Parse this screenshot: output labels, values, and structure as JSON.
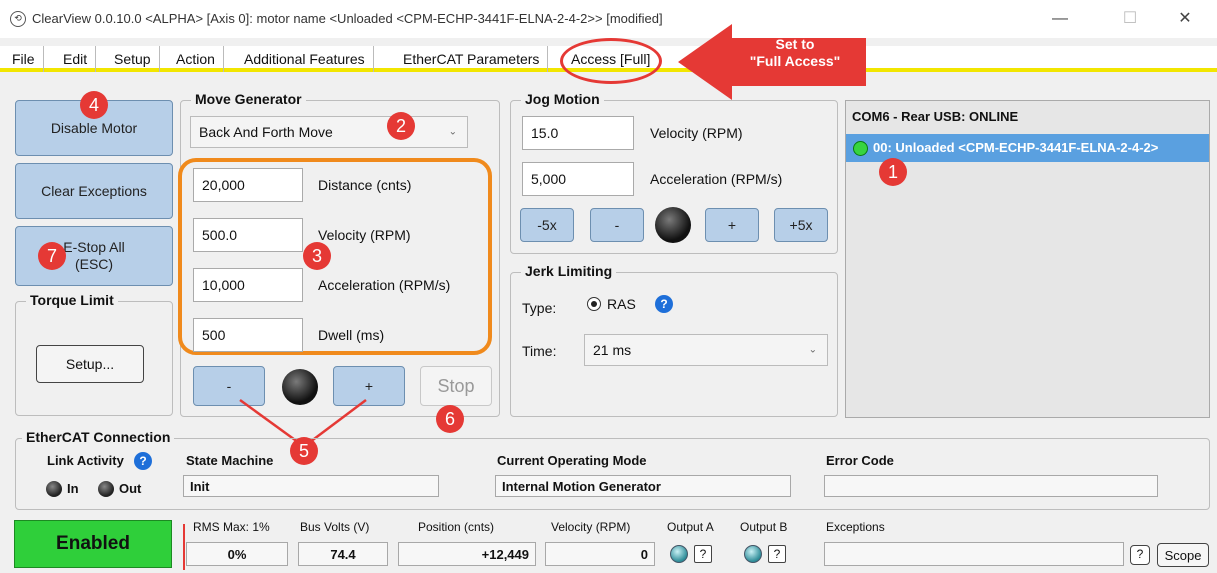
{
  "window": {
    "title": "ClearView 0.0.10.0 <ALPHA> [Axis 0]: motor name <Unloaded <CPM-ECHP-3441F-ELNA-2-4-2>> [modified]",
    "minimize": "—",
    "maximize": "☐",
    "close": "✕"
  },
  "menu": [
    "File",
    "Edit",
    "Setup",
    "Action",
    "Additional Features",
    "EtherCAT Parameters",
    "Access [Full]"
  ],
  "callout": {
    "line1": "Set to",
    "line2": "\"Full Access\""
  },
  "left": {
    "disable_motor": "Disable Motor",
    "clear_exceptions": "Clear Exceptions",
    "estop_line1": "E-Stop All",
    "estop_line2": "(ESC)",
    "torque_title": "Torque Limit",
    "setup": "Setup..."
  },
  "move_generator": {
    "title": "Move Generator",
    "mode": "Back And Forth Move",
    "fields": [
      {
        "value": "20,000",
        "label": "Distance (cnts)"
      },
      {
        "value": "500.0",
        "label": "Velocity (RPM)"
      },
      {
        "value": "10,000",
        "label": "Acceleration (RPM/s)"
      },
      {
        "value": "500",
        "label": "Dwell (ms)"
      }
    ],
    "minus": "-",
    "plus": "+",
    "stop": "Stop"
  },
  "jog": {
    "title": "Jog Motion",
    "velocity_value": "15.0",
    "velocity_label": "Velocity (RPM)",
    "accel_value": "5,000",
    "accel_label": "Acceleration (RPM/s)",
    "buttons": [
      "-5x",
      "-",
      "+",
      "+5x"
    ]
  },
  "jerk": {
    "title": "Jerk Limiting",
    "type_label": "Type:",
    "type_value": "RAS",
    "help": "?",
    "time_label": "Time:",
    "time_value": "21 ms"
  },
  "com": {
    "header": "COM6 - Rear USB: ONLINE",
    "node": "00: Unloaded <CPM-ECHP-3441F-ELNA-2-4-2>"
  },
  "ethercat": {
    "title": "EtherCAT Connection",
    "link_activity": "Link Activity",
    "help": "?",
    "in": "In",
    "out": "Out",
    "state_machine_label": "State Machine",
    "state_machine_value": "Init",
    "op_mode_label": "Current Operating Mode",
    "op_mode_value": "Internal Motion Generator",
    "error_code_label": "Error Code",
    "error_code_value": ""
  },
  "status": {
    "enabled": "Enabled",
    "rms_label": "RMS Max: 1%",
    "rms_value": "0%",
    "bus_label": "Bus Volts (V)",
    "bus_value": "74.4",
    "pos_label": "Position (cnts)",
    "pos_value": "+12,449",
    "vel_label": "Velocity (RPM)",
    "vel_value": "0",
    "outa_label": "Output A",
    "outb_label": "Output B",
    "q": "?",
    "exceptions_label": "Exceptions",
    "exceptions_value": "",
    "scope": "Scope"
  },
  "badges": [
    "1",
    "2",
    "3",
    "4",
    "5",
    "6",
    "7"
  ],
  "colors": {
    "accent_blue": "#b7cfe8",
    "enabled_green": "#2fcf3a",
    "selection_blue": "#5aa0e0",
    "badge_red": "#e53935",
    "menu_underline": "#f2e600"
  }
}
